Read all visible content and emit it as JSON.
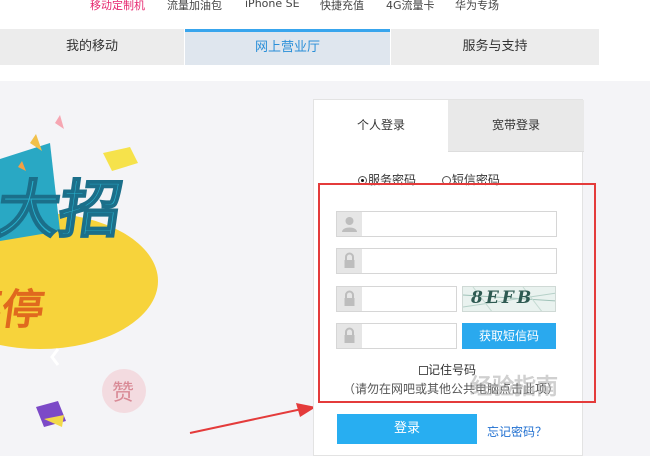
{
  "top_nav": {
    "items": [
      "移动定制机",
      "流量加油包",
      "iPhone SE",
      "快捷充值",
      "4G流量卡",
      "华为专场"
    ]
  },
  "main_nav": {
    "tabs": [
      "我的移动",
      "网上营业厅",
      "服务与支持"
    ],
    "active_tab": "网上营业厅",
    "accent_color": "#38a5ed"
  },
  "banner": {
    "chars": [
      "大招",
      "不停",
      "赞"
    ]
  },
  "login": {
    "tabs": [
      "个人登录",
      "宽带登录"
    ],
    "active_tab": "个人登录",
    "radio_options": [
      "服务密码",
      "短信密码"
    ],
    "selected_radio": "服务密码",
    "captcha_text": "8EFB",
    "sms_button": "获取短信码",
    "remember_label": "记住号码",
    "warning": "（请勿在网吧或其他公共电脑点击此项）",
    "login_button": "登录",
    "forgot_link": "忘记密码？",
    "icons": [
      "user-icon",
      "lock-icon",
      "lock-icon",
      "lock-icon"
    ],
    "button_color": "#28aef1",
    "highlight_color": "#e43b3b"
  },
  "watermark": "经验指南"
}
